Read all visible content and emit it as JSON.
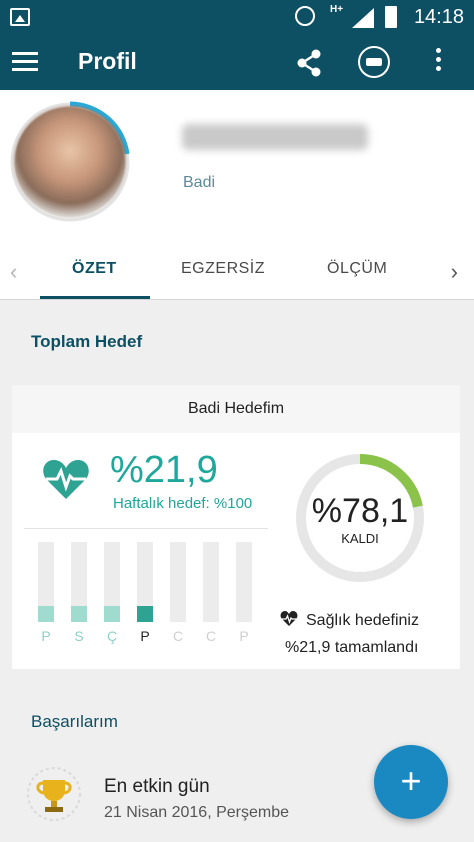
{
  "status_bar": {
    "time": "14:18",
    "network": "H+"
  },
  "app_bar": {
    "title": "Profil"
  },
  "profile": {
    "subtitle": "Badi"
  },
  "tabs": [
    {
      "label": "ÖZET",
      "active": true
    },
    {
      "label": "EGZERSİZ",
      "active": false
    },
    {
      "label": "ÖLÇÜM",
      "active": false
    }
  ],
  "summary": {
    "section_title": "Toplam Hedef",
    "card_title": "Badi Hedefim",
    "progress_pct": "%21,9",
    "weekly_target": "Haftalık hedef: %100",
    "days": [
      {
        "label": "P",
        "fill": 0.2,
        "state": "done"
      },
      {
        "label": "S",
        "fill": 0.2,
        "state": "done"
      },
      {
        "label": "Ç",
        "fill": 0.2,
        "state": "done"
      },
      {
        "label": "P",
        "fill": 0.2,
        "state": "today"
      },
      {
        "label": "C",
        "fill": 0,
        "state": "future"
      },
      {
        "label": "C",
        "fill": 0,
        "state": "future"
      },
      {
        "label": "P",
        "fill": 0,
        "state": "future"
      }
    ],
    "remaining_pct": "%78,1",
    "remaining_label": "KALDI",
    "completed_fraction": 0.219,
    "health_line1": "Sağlık hedefiniz",
    "health_line2": "%21,9 tamamlandı"
  },
  "achievements": {
    "section_title": "Başarılarım",
    "item_title": "En etkin gün",
    "item_date": "21 Nisan 2016, Perşembe"
  },
  "fab": {
    "label": "+"
  },
  "colors": {
    "primary": "#0d4f63",
    "accent": "#1ea79a",
    "fab": "#1a89c1",
    "ring": "#8bc34a"
  }
}
